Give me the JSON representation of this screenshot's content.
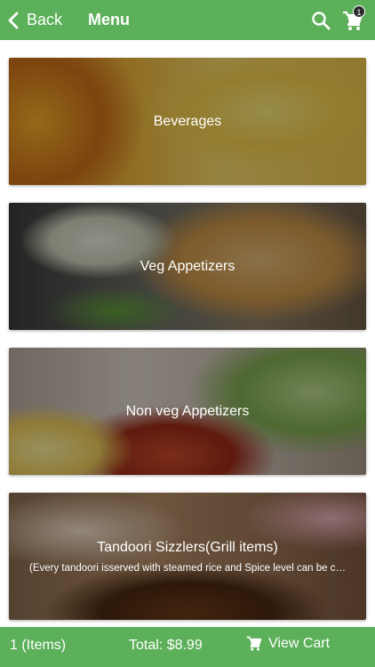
{
  "header": {
    "back_label": "Back",
    "title": "Menu",
    "cart_badge": "1",
    "icons": {
      "back": "chevron-left-icon",
      "search": "search-icon",
      "cart": "cart-icon"
    }
  },
  "categories": [
    {
      "name": "Beverages",
      "description": ""
    },
    {
      "name": "Veg Appetizers",
      "description": ""
    },
    {
      "name": "Non veg Appetizers",
      "description": ""
    },
    {
      "name": "Tandoori Sizzlers(Grill items)",
      "description": "(Every tandoori isserved with steamed rice and Spice level can be c…"
    }
  ],
  "footer": {
    "items": "1 (Items)",
    "total": "Total: $8.99",
    "view_cart": "View Cart"
  },
  "colors": {
    "primary": "#5cb05a",
    "badge": "#2b2b2b"
  }
}
